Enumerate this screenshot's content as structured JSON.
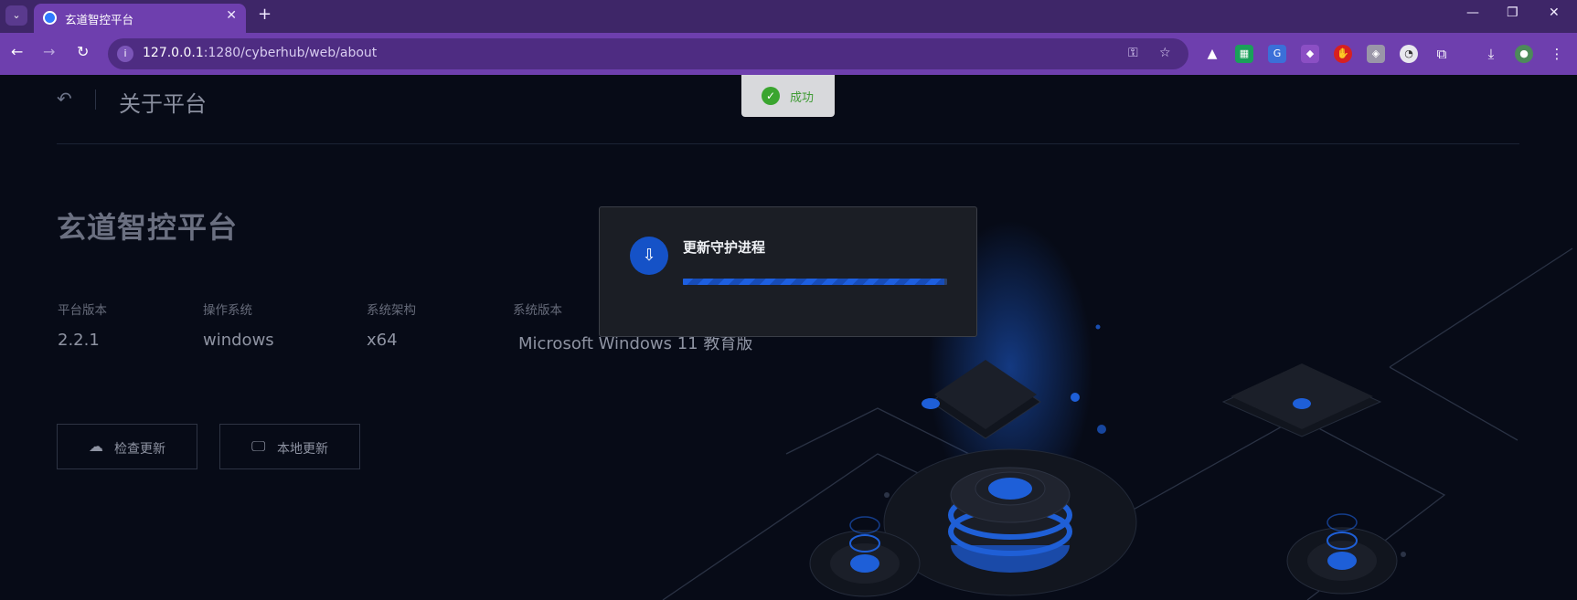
{
  "browser": {
    "tab_title": "玄道智控平台",
    "url_host": "127.0.0.1",
    "url_rest": ":1280/cyberhub/web/about"
  },
  "page": {
    "title": "关于平台",
    "platform_name": "玄道智控平台",
    "info": [
      {
        "label": "平台版本",
        "value": "2.2.1"
      },
      {
        "label": "操作系统",
        "value": "windows"
      },
      {
        "label": "系统架构",
        "value": "x64"
      },
      {
        "label": "系统版本",
        "value": "Microsoft Windows 11 教育版"
      }
    ],
    "buttons": {
      "check_update": "检查更新",
      "local_update": "本地更新"
    }
  },
  "toast": {
    "text": "成功",
    "color": "#3aa52f"
  },
  "dialog": {
    "title": "更新守护进程",
    "progress": 0.99
  },
  "colors": {
    "accent": "#1552c7",
    "chrome": "#6e3fae"
  }
}
